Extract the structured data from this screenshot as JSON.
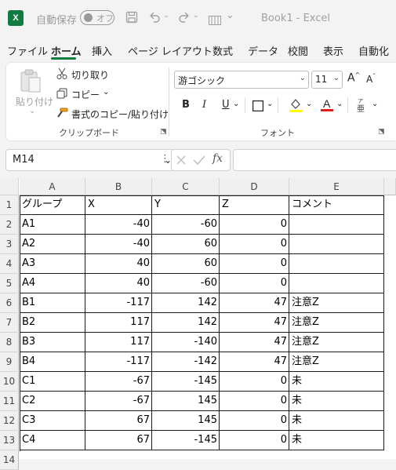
{
  "titlebar": {
    "app_logo": "X",
    "autosave_label": "自動保存",
    "autosave_state": "オフ",
    "document_title": "Book1  -  Excel",
    "icons": [
      "save-icon",
      "undo-icon",
      "redo-icon",
      "view-icon"
    ]
  },
  "ribbon_tabs": [
    "ファイル",
    "ホーム",
    "挿入",
    "ページ レイアウト",
    "数式",
    "データ",
    "校閲",
    "表示",
    "自動化"
  ],
  "active_tab": "ホーム",
  "clipboard": {
    "paste_label": "貼り付け",
    "cut_label": "切り取り",
    "copy_label": "コピー",
    "format_painter_label": "書式のコピー/貼り付け",
    "group_label": "クリップボード"
  },
  "font": {
    "font_name": "游ゴシック",
    "font_size": "11",
    "bold": "B",
    "italic": "I",
    "underline": "U",
    "group_label": "フォント",
    "colors": {
      "highlight": "#ffff00",
      "font_color": "#e02020"
    }
  },
  "formula_bar": {
    "name_box": "M14",
    "fx_label": "fx",
    "formula": ""
  },
  "sheet": {
    "columns": [
      "A",
      "B",
      "C",
      "D",
      "E"
    ],
    "rows": [
      [
        "グループ",
        "X",
        "Y",
        "Z",
        "コメント"
      ],
      [
        "A1",
        "-40",
        "-60",
        "0",
        ""
      ],
      [
        "A2",
        "-40",
        "60",
        "0",
        ""
      ],
      [
        "A3",
        "40",
        "60",
        "0",
        ""
      ],
      [
        "A4",
        "40",
        "-60",
        "0",
        ""
      ],
      [
        "B1",
        "-117",
        "142",
        "47",
        "注意Z"
      ],
      [
        "B2",
        "117",
        "142",
        "47",
        "注意Z"
      ],
      [
        "B3",
        "117",
        "-140",
        "47",
        "注意Z"
      ],
      [
        "B4",
        "-117",
        "-142",
        "47",
        "注意Z"
      ],
      [
        "C1",
        "-67",
        "-145",
        "0",
        "未"
      ],
      [
        "C2",
        "-67",
        "145",
        "0",
        "未"
      ],
      [
        "C3",
        "67",
        "145",
        "0",
        "未"
      ],
      [
        "C4",
        "67",
        "-145",
        "0",
        "未"
      ]
    ],
    "row_numbers": [
      "1",
      "2",
      "3",
      "4",
      "5",
      "6",
      "7",
      "8",
      "9",
      "10",
      "11",
      "12",
      "13",
      "14"
    ]
  },
  "accent_color": "#107c41"
}
